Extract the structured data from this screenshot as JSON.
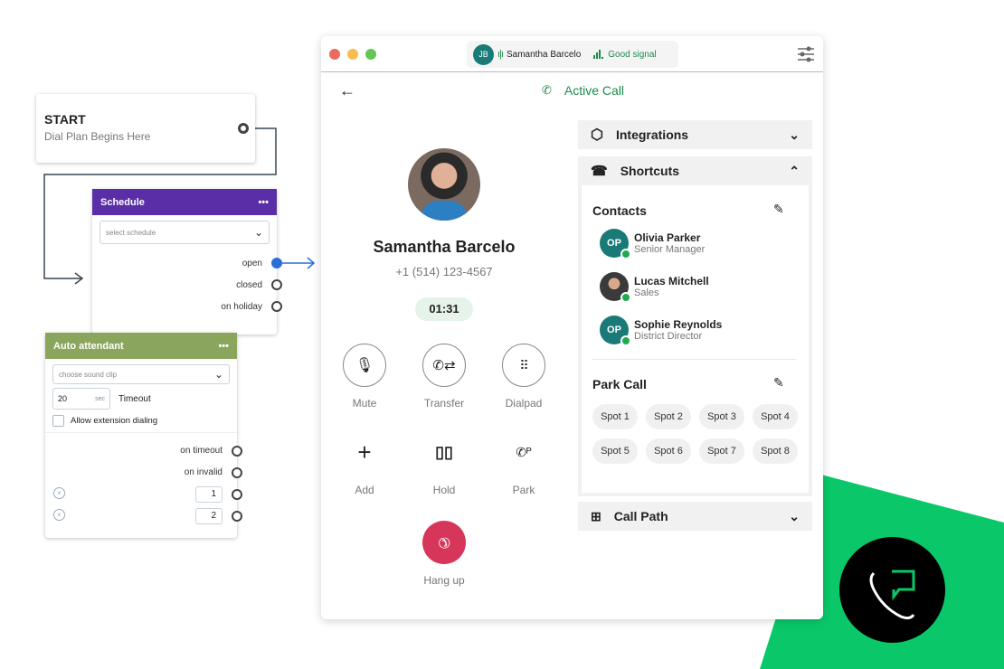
{
  "flow": {
    "start": {
      "title": "START",
      "subtitle": "Dial Plan Begins Here"
    },
    "schedule": {
      "title": "Schedule",
      "menu": "•••",
      "select_placeholder": "select schedule",
      "outputs": [
        "open",
        "closed",
        "on holiday"
      ],
      "color": "#5a2ea6"
    },
    "auto_attendant": {
      "title": "Auto attendant",
      "menu": "•••",
      "select_placeholder": "choose sound clip",
      "timeout_value": "20",
      "timeout_unit": "sec",
      "timeout_label": "Timeout",
      "checkbox_label": "Allow extension dialing",
      "checkbox_checked": false,
      "outputs": [
        "on timeout",
        "on invalid"
      ],
      "digits": [
        "1",
        "2"
      ],
      "color": "#8aa65c"
    }
  },
  "window": {
    "caller_initials": "JB",
    "caller_name": "Samantha Barcelo",
    "signal": "Good signal",
    "header_title": "Active Call",
    "contact": {
      "name": "Samantha Barcelo",
      "phone": "+1 (514) 123-4567",
      "timer": "01:31"
    },
    "controls": [
      {
        "label": "Mute",
        "icon": "microphone-icon"
      },
      {
        "label": "Transfer",
        "icon": "transfer-icon"
      },
      {
        "label": "Dialpad",
        "icon": "dialpad-icon"
      },
      {
        "label": "Add",
        "icon": "plus-icon"
      },
      {
        "label": "Hold",
        "icon": "pause-icon"
      },
      {
        "label": "Park",
        "icon": "park-icon"
      }
    ],
    "hangup": "Hang up",
    "panel": {
      "integrations": "Integrations",
      "shortcuts": "Shortcuts",
      "contacts_title": "Contacts",
      "contacts": [
        {
          "initials": "OP",
          "name": "Olivia Parker",
          "role": "Senior Manager"
        },
        {
          "initials": "",
          "name": "Lucas Mitchell",
          "role": "Sales"
        },
        {
          "initials": "OP",
          "name": "Sophie Reynolds",
          "role": "District Director"
        }
      ],
      "park_title": "Park Call",
      "spots": [
        "Spot 1",
        "Spot 2",
        "Spot 3",
        "Spot 4",
        "Spot 5",
        "Spot 6",
        "Spot 7",
        "Spot 8"
      ],
      "call_path": "Call Path"
    }
  },
  "colors": {
    "accent_green": "#1e8a4c",
    "brand_green": "#0ac86a",
    "hangup": "#d6365a",
    "teal": "#197a78"
  }
}
